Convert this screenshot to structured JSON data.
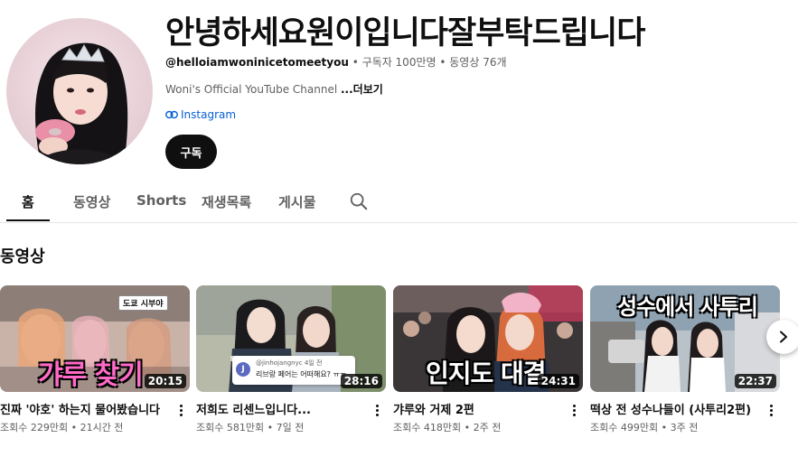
{
  "channel": {
    "name": "안녕하세요원이입니다잘부탁드립니다",
    "handle": "@helloiamwoninicetomeetyou",
    "subscribers": "구독자 100만명",
    "video_count": "동영상 76개",
    "separator": "•",
    "description": "Woni's Official YouTube Channel",
    "more_label": "...더보기",
    "link_label": "Instagram",
    "subscribe_label": "구독"
  },
  "tabs": [
    {
      "label": "홈",
      "active": true
    },
    {
      "label": "동영상"
    },
    {
      "label": "Shorts"
    },
    {
      "label": "재생목록"
    },
    {
      "label": "게시물"
    }
  ],
  "section": {
    "title": "동영상"
  },
  "videos": [
    {
      "title": "진짜 '야호' 하는지 물어봤습니다",
      "meta": "조회수 229만회 • 21시간 전",
      "duration": "20:15",
      "thumb_caption": "갸루 찾기",
      "thumb_tag": "도쿄 시부야"
    },
    {
      "title": "저희도 리센느입니다...",
      "meta": "조회수 581만회 • 7일 전",
      "duration": "28:16",
      "comment_user": "@jinhojangnyc",
      "comment_time": "4일 전",
      "comment_text": "리브랑 페어는 어떠해요? ㅠㅠ",
      "comment_avatar": "J"
    },
    {
      "title": "갸루와 거제 2편",
      "meta": "조회수 418만회 • 2주 전",
      "duration": "24:31",
      "thumb_caption": "인지도 대결"
    },
    {
      "title": "떡상 전 성수나들이 (사투리2편)",
      "meta": "조회수 499만회 • 3주 전",
      "duration": "22:37",
      "thumb_caption": "성수에서 사투리"
    }
  ],
  "icons": {
    "search": "search-icon",
    "link": "link-icon",
    "more_vert": "more-vert-icon",
    "next": "chevron-right-icon"
  },
  "colors": {
    "subscribe_bg": "#0f0f0f",
    "link": "#065fd4",
    "secondary_text": "#606060"
  }
}
